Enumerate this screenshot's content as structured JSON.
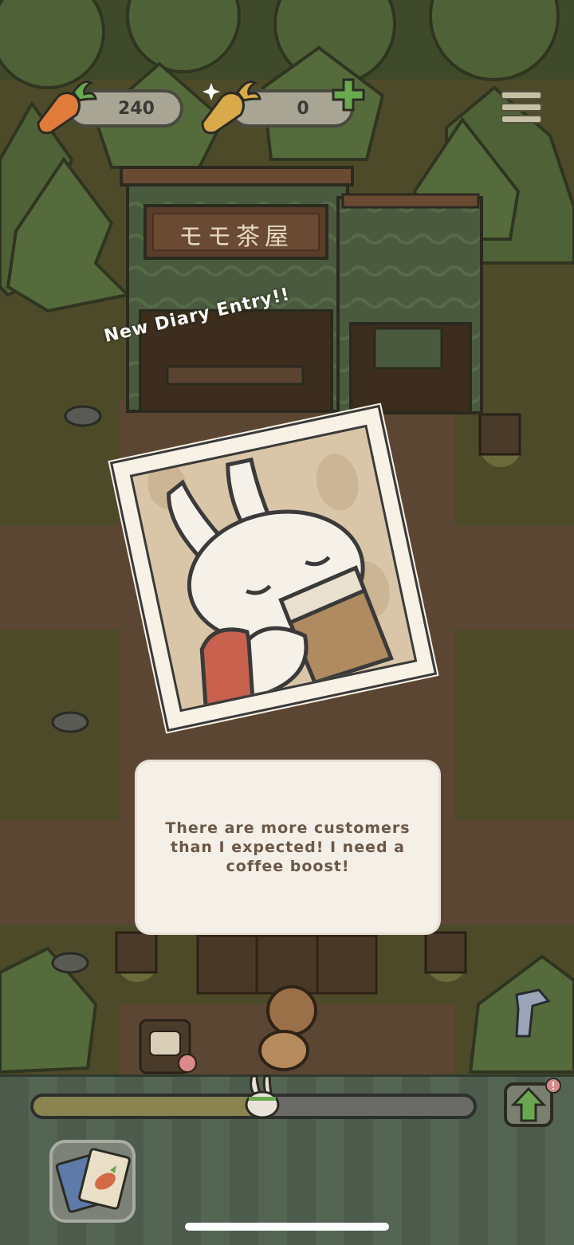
{
  "hud": {
    "carrots": "240",
    "golden_carrots": "0",
    "carrot_icon": "carrot-icon",
    "golden_carrot_icon": "golden-carrot-icon",
    "plus_icon": "plus-icon",
    "menu_icon": "hamburger-menu-icon"
  },
  "shop": {
    "sign": "モモ茶屋"
  },
  "diary": {
    "title": "New Diary Entry!!",
    "photo_subject": "bunny-drinking-coffee",
    "message": "There are more customers than I expected! I need a coffee boost!"
  },
  "bottom_bar": {
    "progress": 0.49,
    "upgrade_icon": "up-arrow-icon",
    "cards_icon": "cards-icon"
  },
  "colors": {
    "grass": "#4d4a2a",
    "path": "#5b4633",
    "dialog_bg": "#f4efe7",
    "dialog_text": "#6b5847",
    "accent_green": "#6aa84f"
  }
}
